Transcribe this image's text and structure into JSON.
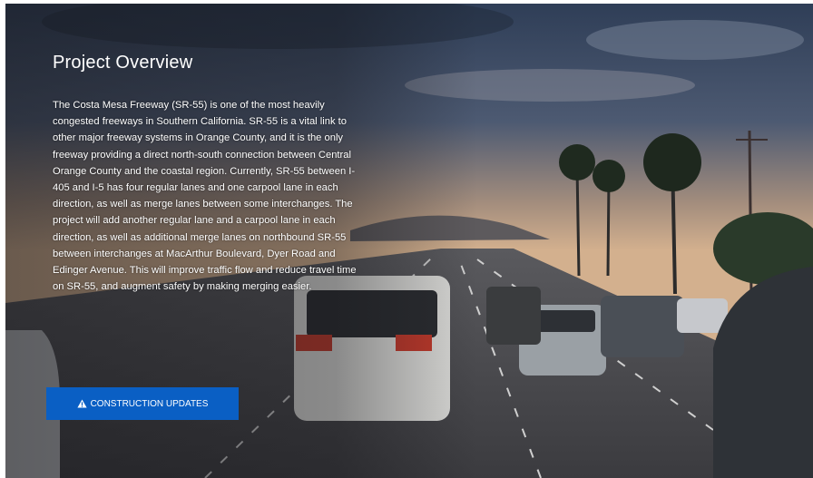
{
  "hero": {
    "title": "Project Overview",
    "description": "The Costa Mesa Freeway (SR-55) is one of the most heavily congested freeways in Southern California. SR-55 is a vital link to other major freeway systems in Orange County, and it is the only freeway providing a direct north-south connection between Central Orange County and the coastal region. Currently, SR-55 between I-405 and I-5 has four regular lanes and one carpool lane in each direction, as well as merge lanes between some interchanges. The project will add another regular lane and a carpool lane in each direction, as well as additional merge lanes on northbound SR-55 between interchanges at MacArthur Boulevard, Dyer Road and Edinger Avenue. This will improve traffic flow and reduce travel time on SR-55, and augment safety by making merging easier.",
    "button_label": "CONSTRUCTION UPDATES",
    "button_icon": "warning-triangle-icon"
  },
  "colors": {
    "button": "#0a5fc4",
    "text": "#ffffff",
    "sky_top": "#3a4f6b",
    "sky_bottom": "#c9a98a"
  }
}
